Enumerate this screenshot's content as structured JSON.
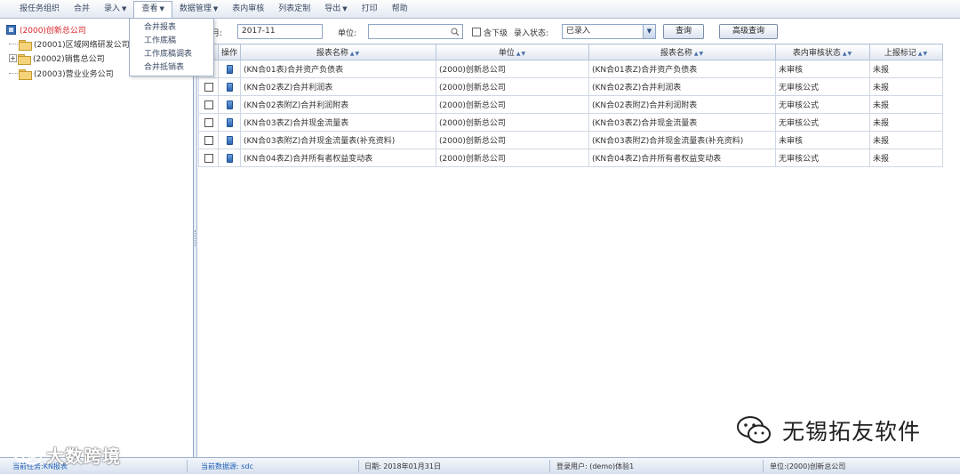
{
  "menubar": {
    "items": [
      {
        "label": "报任务组织",
        "caret": false
      },
      {
        "label": "合并",
        "caret": false
      },
      {
        "label": "录入",
        "caret": true
      },
      {
        "label": "查看",
        "caret": true
      },
      {
        "label": "数据管理",
        "caret": true
      },
      {
        "label": "表内审核",
        "caret": false
      },
      {
        "label": "列表定制",
        "caret": false
      },
      {
        "label": "导出",
        "caret": true
      },
      {
        "label": "打印",
        "caret": false
      },
      {
        "label": "帮助",
        "caret": false
      }
    ],
    "dropdown": [
      "合并报表",
      "工作底稿",
      "工作底稿调表",
      "合并抵销表"
    ]
  },
  "tree": {
    "root": "(2000)创新总公司",
    "children": [
      "(20001)区域网络研发公司",
      "(20002)销售总公司",
      "(20003)营业业务公司"
    ]
  },
  "filter": {
    "month_label": "月:",
    "month_value": "2017-11",
    "entity_label": "单位:",
    "entity_value": "",
    "include_sub_label": "含下级",
    "status_label": "录入状态:",
    "status_value": "已录入",
    "query_button": "查询",
    "advanced_button": "高级查询"
  },
  "grid": {
    "columns": [
      "",
      "操作",
      "报表名称",
      "单位",
      "报表名称",
      "表内审核状态",
      "上报标记"
    ],
    "rows": [
      {
        "report": "(KN合01表)合并资产负债表",
        "unit": "(2000)创新总公司",
        "report2": "(KN合01表Z)合并资产负债表",
        "audit": "未审核",
        "flag": "未报"
      },
      {
        "report": "(KN合02表Z)合并利润表",
        "unit": "(2000)创新总公司",
        "report2": "(KN合02表Z)合并利润表",
        "audit": "无审核公式",
        "flag": "未报"
      },
      {
        "report": "(KN合02表附Z)合并利润附表",
        "unit": "(2000)创新总公司",
        "report2": "(KN合02表附Z)合并利润附表",
        "audit": "无审核公式",
        "flag": "未报"
      },
      {
        "report": "(KN合03表Z)合并现金流量表",
        "unit": "(2000)创新总公司",
        "report2": "(KN合03表Z)合并现金流量表",
        "audit": "无审核公式",
        "flag": "未报"
      },
      {
        "report": "(KN合03表附Z)合并现金流量表(补充资料)",
        "unit": "(2000)创新总公司",
        "report2": "(KN合03表附Z)合并现金流量表(补充资料)",
        "audit": "未审核",
        "flag": "未报"
      },
      {
        "report": "(KN合04表Z)合并所有者权益变动表",
        "unit": "(2000)创新总公司",
        "report2": "(KN合04表Z)合并所有者权益变动表",
        "audit": "无审核公式",
        "flag": "未报"
      }
    ]
  },
  "statusbar": {
    "task": "当前任务:KN报表",
    "user_label": "当前数据源: sdc",
    "date": "日期: 2018年01月31日",
    "login": "登录用户: (demo)体验1",
    "unit": "单位:(2000)创新总公司"
  },
  "watermark": {
    "right_text": "无锡拓友软件",
    "left_text": "大数跨境"
  }
}
